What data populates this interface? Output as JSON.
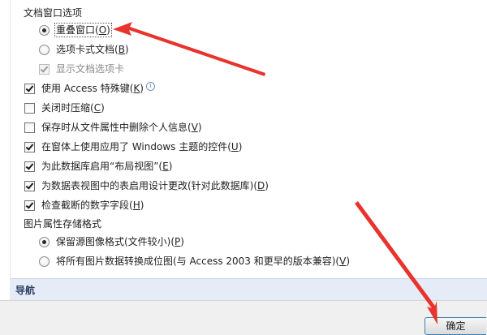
{
  "document_window_options": {
    "title": "文档窗口选项",
    "overlapping_windows": {
      "text": "重叠窗口(",
      "key": "O",
      "suffix": ")"
    },
    "tabbed_documents": {
      "text": "选项卡式文档(",
      "key": "B",
      "suffix": ")"
    },
    "display_document_tabs": {
      "text": "显示文档选项卡"
    }
  },
  "options": {
    "access_special_keys": {
      "text": "使用 Access 特殊键(",
      "key": "K",
      "suffix": ")"
    },
    "compact_on_close": {
      "text": "关闭时压缩(",
      "key": "C",
      "suffix": ")"
    },
    "remove_personal_info": {
      "text": "保存时从文件属性中删除个人信息(",
      "key": "V",
      "suffix": ")"
    },
    "windows_themed_controls": {
      "text": "在窗体上使用应用了 Windows 主题的控件(",
      "key": "U",
      "suffix": ")"
    },
    "enable_layout_view": {
      "text": "为此数据库启用“布局视图”(",
      "key": "E",
      "suffix": ")"
    },
    "enable_design_changes": {
      "text": "为数据表视图中的表启用设计更改(针对此数据库)(",
      "key": "D",
      "suffix": ")"
    },
    "check_truncated_fields": {
      "text": "检查截断的数字字段(",
      "key": "H",
      "suffix": ")"
    }
  },
  "picture_storage": {
    "title": "图片属性存储格式",
    "preserve_source_format": {
      "text": "保留源图像格式(文件较小)(",
      "key": "P",
      "suffix": ")"
    },
    "convert_to_bitmap": {
      "text": "将所有图片数据转换成位图(与 Access 2003 和更早的版本兼容)(",
      "key": "V",
      "suffix": ")"
    }
  },
  "navigation": {
    "title": "导航"
  },
  "footer": {
    "ok_label": "确定"
  },
  "colors": {
    "annotation_arrow": "#e8342d",
    "section_bar": "#e5ecf7",
    "button_border": "#3c7fb1"
  }
}
